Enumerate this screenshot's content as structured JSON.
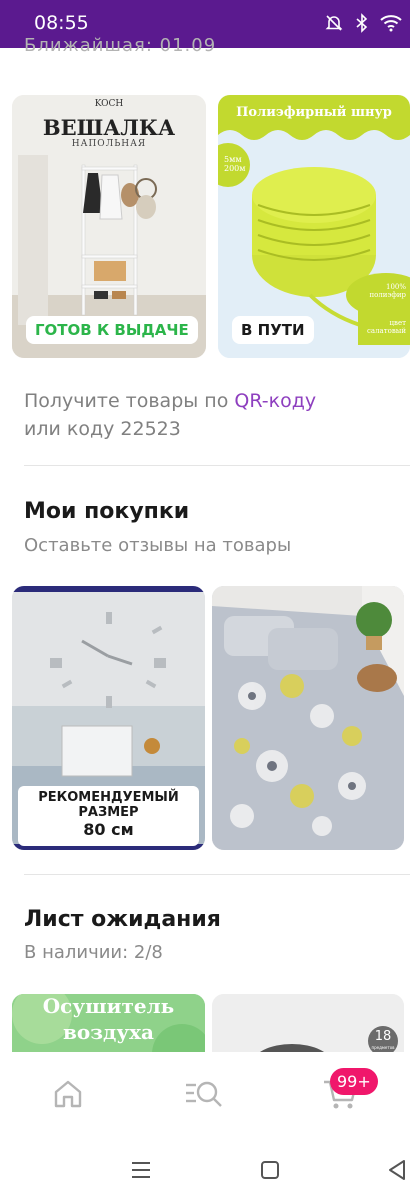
{
  "status_bar": {
    "time": "08:55",
    "icons": [
      "mute-bell-icon",
      "bluetooth-icon",
      "wifi-icon"
    ]
  },
  "pickup": {
    "cut_off_text": "Ближайшая: 01.09",
    "items": [
      {
        "image_icon": "clothes-rack-photo",
        "image_title": "ВЕШАЛКА",
        "image_subtitle": "НАПОЛЬНАЯ",
        "brand": "KOCH",
        "status": "ГОТОВ К ВЫДАЧЕ",
        "status_color": "#2cb54a"
      },
      {
        "image_icon": "cord-spool-photo",
        "image_title": "Полиэфирный шнур",
        "image_note": "5мм\n200м",
        "image_note2": "100%\nполиэфир",
        "image_note3": "цвет\nсалатовый",
        "status": "В ПУТИ",
        "status_color": "#1a1a1a"
      }
    ],
    "hint_prefix": "Получите товары по ",
    "hint_link": "QR-коду",
    "hint_suffix": "или коду 22523"
  },
  "purchases": {
    "title": "Мои покупки",
    "subtitle": "Оставьте отзывы на товары",
    "items": [
      {
        "image_icon": "wall-clock-photo",
        "caption_line1": "РЕКОМЕНДУЕМЫЙ",
        "caption_line2": "РАЗМЕР",
        "caption_size": "80 см"
      },
      {
        "image_icon": "bedding-set-photo"
      }
    ]
  },
  "waitlist": {
    "title": "Лист ожидания",
    "subtitle": "В наличии: 2/8",
    "items": [
      {
        "image_icon": "air-dryer-photo",
        "image_title_1": "Осушитель",
        "image_title_2": "воздуха"
      },
      {
        "image_icon": "product-photo",
        "count": "18",
        "count_label": "предметов"
      }
    ]
  },
  "bottom_nav": {
    "items": [
      "home-icon",
      "catalog-search-icon",
      "cart-icon"
    ],
    "cart_badge": "99+"
  },
  "system_nav": [
    "menu-icon",
    "home-square-icon",
    "back-icon"
  ],
  "colors": {
    "status_bar": "#5b1a8f",
    "accent": "#8e3fbf",
    "ready": "#2cb54a",
    "badge": "#f0176b"
  }
}
